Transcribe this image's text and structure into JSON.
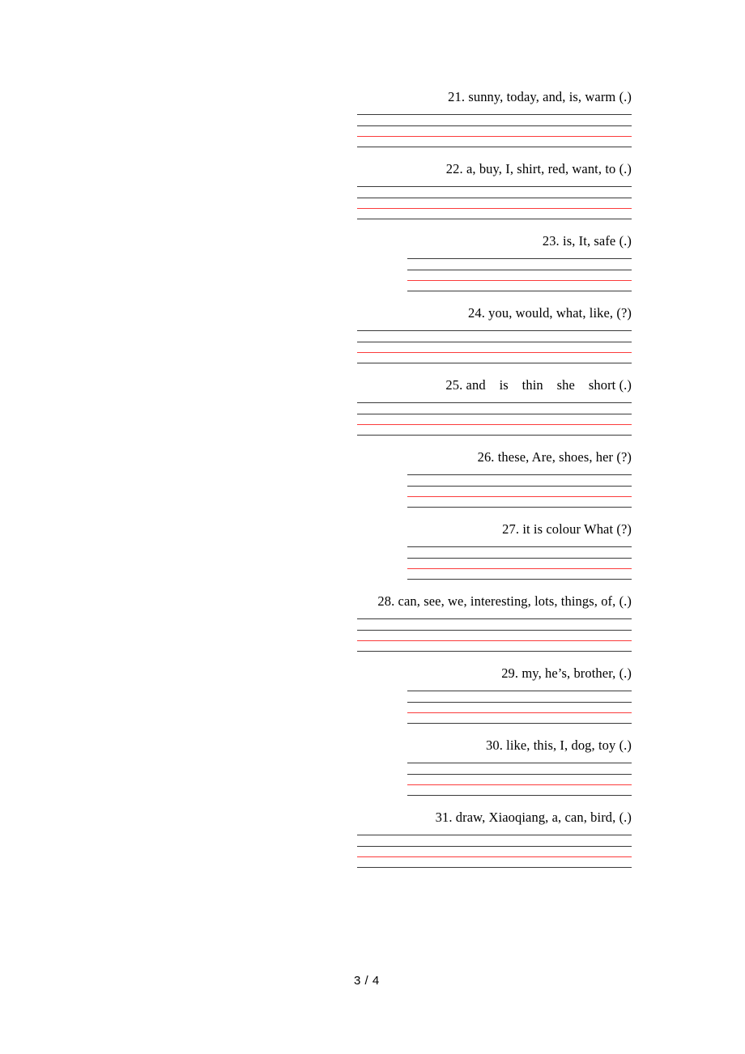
{
  "document": {
    "page_label": "3 / 4",
    "rule_colors": {
      "black": "#3a3a3a",
      "red": "#fb3b3b"
    }
  },
  "questions": [
    {
      "number": "21.",
      "text": "21. sunny, today, and, is, warm (.)",
      "rule_width": 339
    },
    {
      "number": "22.",
      "text": "22. a, buy, I, shirt, red, want, to (.)",
      "rule_width": 339
    },
    {
      "number": "23.",
      "text": "23. is, It, safe (.)",
      "rule_width": 277
    },
    {
      "number": "24.",
      "text": "24. you, would, what, like, (?)",
      "rule_width": 339
    },
    {
      "number": "25.",
      "text": "25. and    is    thin    she    short (.)",
      "rule_width": 339
    },
    {
      "number": "26.",
      "text": "26. these, Are, shoes, her (?)",
      "rule_width": 277
    },
    {
      "number": "27.",
      "text": "27. it is colour What (?)",
      "rule_width": 277
    },
    {
      "number": "28.",
      "text": "28. can, see, we, interesting, lots, things, of, (.)",
      "rule_width": 339
    },
    {
      "number": "29.",
      "text": "29. my, he’s, brother, (.)",
      "rule_width": 277
    },
    {
      "number": "30.",
      "text": "30. like, this, I, dog, toy (.)",
      "rule_width": 277
    },
    {
      "number": "31.",
      "text": "31. draw, Xiaoqiang, a, can, bird, (.)",
      "rule_width": 339
    }
  ]
}
